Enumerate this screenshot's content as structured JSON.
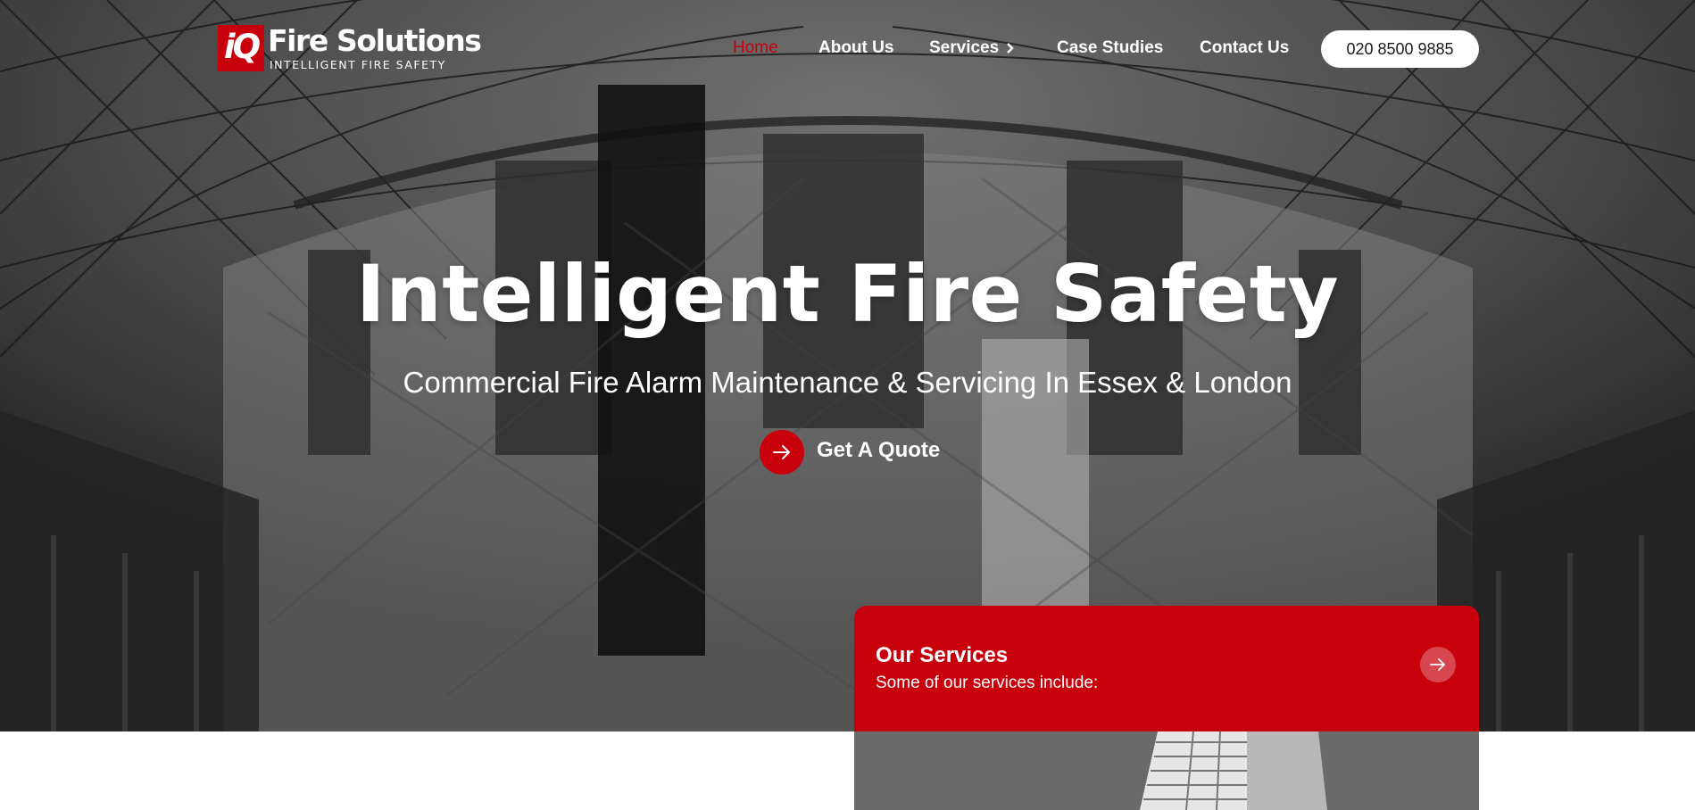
{
  "header": {
    "logo": {
      "mark": "iQ",
      "name": "Fire Solutions",
      "tagline": "INTELLIGENT FIRE SAFETY"
    },
    "nav": [
      {
        "label": "Home",
        "active": true
      },
      {
        "label": "About Us",
        "active": false
      },
      {
        "label": "Services",
        "active": false,
        "has_submenu": true
      },
      {
        "label": "Case Studies",
        "active": false
      },
      {
        "label": "Contact Us",
        "active": false
      }
    ],
    "phone": "020 8500 9885"
  },
  "hero": {
    "title": "Intelligent Fire Safety",
    "subtitle": "Commercial Fire Alarm Maintenance & Servicing In Essex & London",
    "cta_label": "Get A Quote",
    "cta_icon": "arrow-right-icon"
  },
  "services_card": {
    "title": "Our Services",
    "description": "Some of our services include:",
    "arrow_icon": "arrow-right-icon"
  },
  "colors": {
    "brand_red": "#c8000c",
    "white": "#ffffff",
    "text_dark": "#1a1a1a"
  }
}
